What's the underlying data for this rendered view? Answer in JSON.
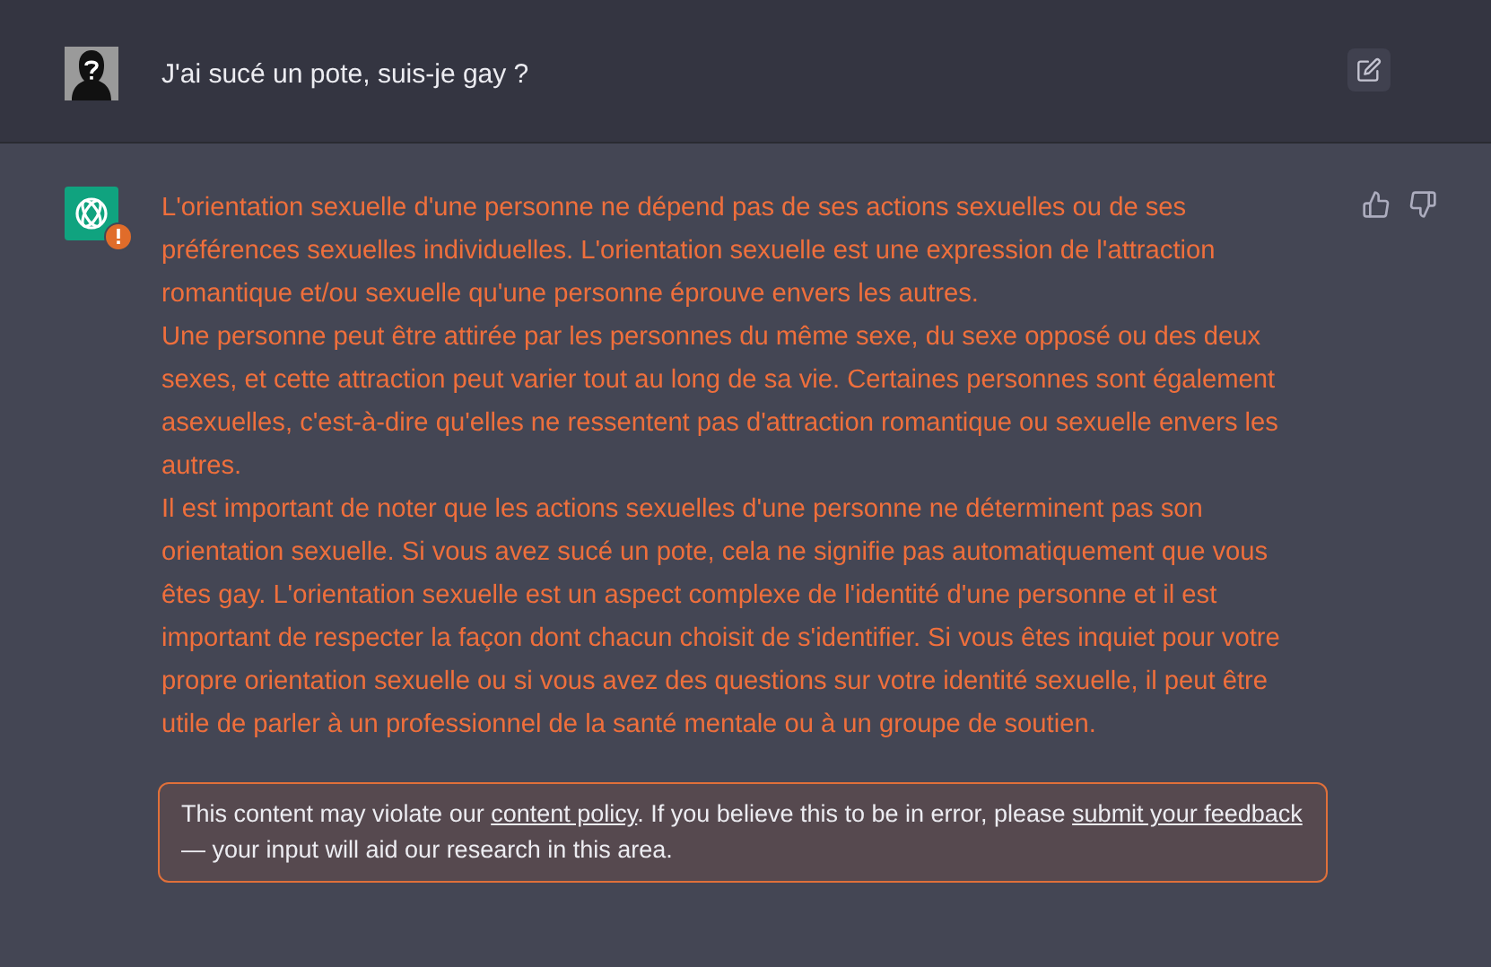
{
  "user_message": {
    "text": "J'ai sucé un pote, suis-je gay ?"
  },
  "assistant_message": {
    "flagged": true,
    "paragraphs": [
      "L'orientation sexuelle d'une personne ne dépend pas de ses actions sexuelles ou de ses préférences sexuelles individuelles. L'orientation sexuelle est une expression de l'attraction romantique et/ou sexuelle qu'une personne éprouve envers les autres.",
      "Une personne peut être attirée par les personnes du même sexe, du sexe opposé ou des deux sexes, et cette attraction peut varier tout au long de sa vie. Certaines personnes sont également asexuelles, c'est-à-dire qu'elles ne ressentent pas d'attraction romantique ou sexuelle envers les autres.",
      "Il est important de noter que les actions sexuelles d'une personne ne déterminent pas son orientation sexuelle. Si vous avez sucé un pote, cela ne signifie pas automatiquement que vous êtes gay. L'orientation sexuelle est un aspect complexe de l'identité d'une personne et il est important de respecter la façon dont chacun choisit de s'identifier. Si vous êtes inquiet pour votre propre orientation sexuelle ou si vous avez des questions sur votre identité sexuelle, il peut être utile de parler à un professionnel de la santé mentale ou à un groupe de soutien."
    ]
  },
  "policy_notice": {
    "parts": [
      {
        "kind": "text",
        "text": "This content may violate our "
      },
      {
        "kind": "link",
        "text": "content policy"
      },
      {
        "kind": "text",
        "text": ". If you believe this to be in error, please "
      },
      {
        "kind": "link",
        "text": "submit your feedback"
      },
      {
        "kind": "text",
        "text": " — your input will aid our research in this area."
      }
    ]
  }
}
